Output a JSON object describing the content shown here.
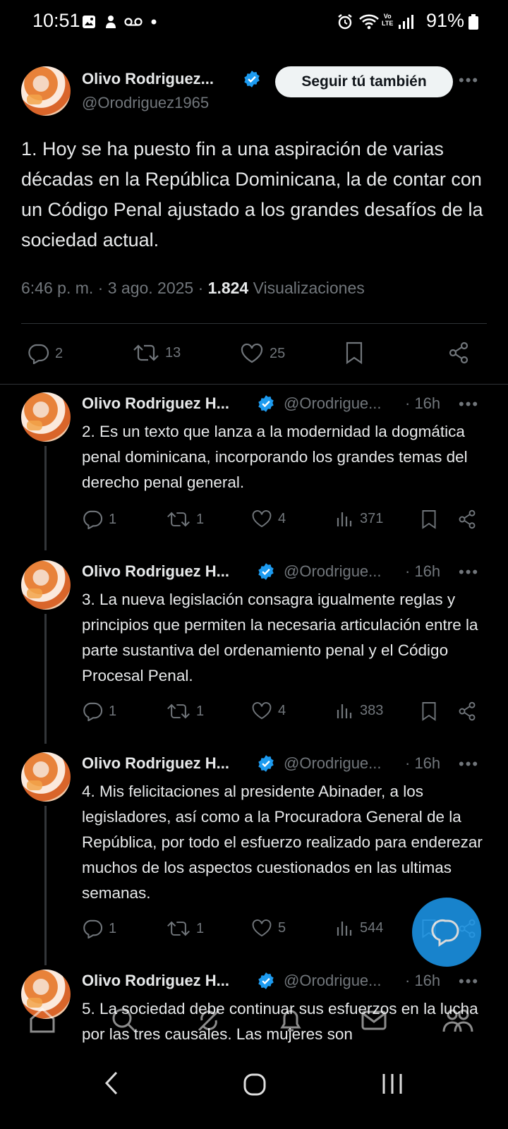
{
  "status_bar": {
    "time": "10:51",
    "battery": "91%"
  },
  "main_tweet": {
    "author_name": "Olivo Rodriguez...",
    "author_handle": "@Orodriguez1965",
    "follow_label": "Seguir tú también",
    "text": "1.  Hoy se ha puesto fin a una aspiración de varias décadas en la República Dominicana, la de contar con un Código Penal ajustado a los grandes desafíos de la sociedad actual.",
    "meta": "6:46 p. m. · 3 ago. 2025 · ",
    "views": "1.824",
    "views_label": "Visualizaciones",
    "replies": "2",
    "retweets": "13",
    "likes": "25"
  },
  "replies": [
    {
      "name": "Olivo Rodriguez H...",
      "handle": "@Orodrigue...",
      "time": "· 16h",
      "text": "2. Es un texto que lanza a la modernidad la dogmática penal dominicana, incorporando los grandes temas del derecho penal general.",
      "replies": "1",
      "retweets": "1",
      "likes": "4",
      "views": "371"
    },
    {
      "name": "Olivo Rodriguez H...",
      "handle": "@Orodrigue...",
      "time": "· 16h",
      "text": "3. La nueva legislación consagra igualmente reglas y principios que permiten la necesaria articulación entre la parte sustantiva del ordenamiento penal y el Código Procesal Penal.",
      "replies": "1",
      "retweets": "1",
      "likes": "4",
      "views": "383"
    },
    {
      "name": "Olivo Rodriguez H...",
      "handle": "@Orodrigue...",
      "time": "· 16h",
      "text": "4. Mis felicitaciones al presidente Abinader, a los legisladores, así como a la Procuradora General de la República, por todo el esfuerzo realizado para enderezar muchos de los aspectos cuestionados en las ultimas semanas.",
      "replies": "1",
      "retweets": "1",
      "likes": "5",
      "views": "544"
    },
    {
      "name": "Olivo Rodriguez H...",
      "handle": "@Orodrigue...",
      "time": "· 16h",
      "text": "5. La sociedad debe continuar sus esfuerzos en la lucha por las tres causales. Las mujeres son"
    }
  ],
  "more_glyph": "•••",
  "colors": {
    "accent": "#1d9bf0",
    "background": "#000000",
    "muted": "#71767b",
    "verified": "#1d9bf0"
  },
  "icons": [
    "reply-icon",
    "retweet-icon",
    "like-icon",
    "bookmark-icon",
    "share-icon",
    "views-icon",
    "verified-icon",
    "home-icon",
    "search-icon",
    "grok-icon",
    "notifications-icon",
    "messages-icon",
    "communities-icon",
    "compose-icon"
  ]
}
